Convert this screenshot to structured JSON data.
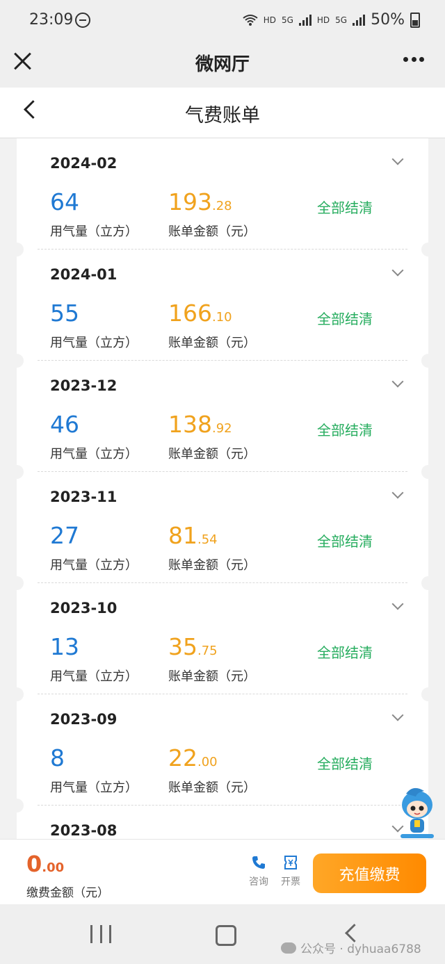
{
  "status": {
    "time": "23:09",
    "battery": "50%",
    "hd1": "HD",
    "hd2": "HD",
    "net1": "5G",
    "net2": "5G"
  },
  "miniprogram": {
    "title": "微网厅"
  },
  "header": {
    "title": "气费账单"
  },
  "labels": {
    "gas": "用气量（立方）",
    "amount": "账单金额（元）"
  },
  "bills": [
    {
      "month": "2024-02",
      "gas": "64",
      "amount_int": "193",
      "amount_dec": ".28",
      "status": "全部结清"
    },
    {
      "month": "2024-01",
      "gas": "55",
      "amount_int": "166",
      "amount_dec": ".10",
      "status": "全部结清"
    },
    {
      "month": "2023-12",
      "gas": "46",
      "amount_int": "138",
      "amount_dec": ".92",
      "status": "全部结清"
    },
    {
      "month": "2023-11",
      "gas": "27",
      "amount_int": "81",
      "amount_dec": ".54",
      "status": "全部结清"
    },
    {
      "month": "2023-10",
      "gas": "13",
      "amount_int": "35",
      "amount_dec": ".75",
      "status": "全部结清"
    },
    {
      "month": "2023-09",
      "gas": "8",
      "amount_int": "22",
      "amount_dec": ".00",
      "status": "全部结清"
    },
    {
      "month": "2023-08",
      "gas": "",
      "amount_int": "",
      "amount_dec": "",
      "status": ""
    }
  ],
  "footer": {
    "pay_int": "0",
    "pay_dec": ".00",
    "pay_label": "缴费金额（元）",
    "consult": "咨询",
    "invoice": "开票",
    "recharge": "充值缴费"
  },
  "watermark": {
    "text": "公众号 · dyhuaa6788"
  },
  "colors": {
    "blue": "#1f79d3",
    "orange": "#f0a21d",
    "green": "#27ad5f",
    "button": "#ff9a1a"
  }
}
